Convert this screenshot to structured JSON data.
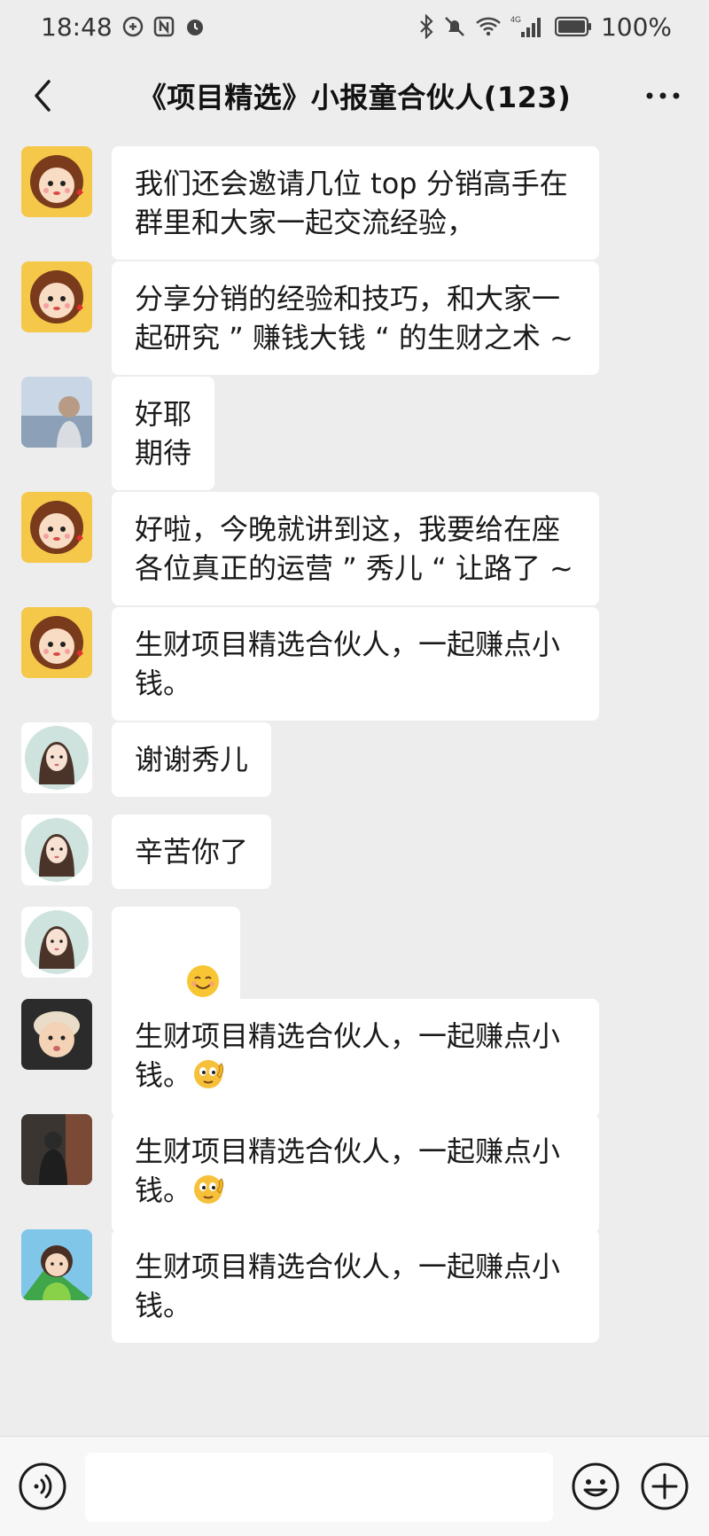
{
  "status_bar": {
    "time": "18:48",
    "battery": "100%",
    "network": "4G"
  },
  "header": {
    "title": "《项目精选》小报童合伙人(123)"
  },
  "messages": [
    {
      "avatar": "cartoon-girl-avatar",
      "text": "我们还会邀请几位 top 分销高手在群里和大家一起交流经验，"
    },
    {
      "avatar": "cartoon-girl-avatar",
      "text": "分享分销的经验和技巧，和大家一起研究 ” 赚钱大钱 “ 的生财之术 ~"
    },
    {
      "avatar": "seaside-photo-avatar",
      "text": "好耶\n期待"
    },
    {
      "avatar": "cartoon-girl-avatar",
      "text": "好啦，今晚就讲到这，我要给在座各位真正的运营 ” 秀儿 “ 让路了 ~"
    },
    {
      "avatar": "cartoon-girl-avatar",
      "text": "生财项目精选合伙人，一起赚点小钱。"
    },
    {
      "avatar": "anime-girl-avatar",
      "text": "谢谢秀儿"
    },
    {
      "avatar": "anime-girl-avatar",
      "text": "辛苦你了"
    },
    {
      "avatar": "anime-girl-avatar",
      "text": "😊"
    },
    {
      "avatar": "baby-photo-avatar",
      "text": "生财项目精选合伙人，一起赚点小钱。",
      "trailing_emoji": "emoji-sticker"
    },
    {
      "avatar": "dark-photo-avatar",
      "text": "生财项目精选合伙人，一起赚点小钱。",
      "trailing_emoji": "emoji-sticker"
    },
    {
      "avatar": "girl-photo-avatar",
      "text": "生财项目精选合伙人，一起赚点小钱。"
    }
  ],
  "input_bar": {
    "placeholder": ""
  },
  "colors": {
    "background": "#ededed",
    "bubble": "#ffffff",
    "input_bar": "#f7f7f7"
  }
}
